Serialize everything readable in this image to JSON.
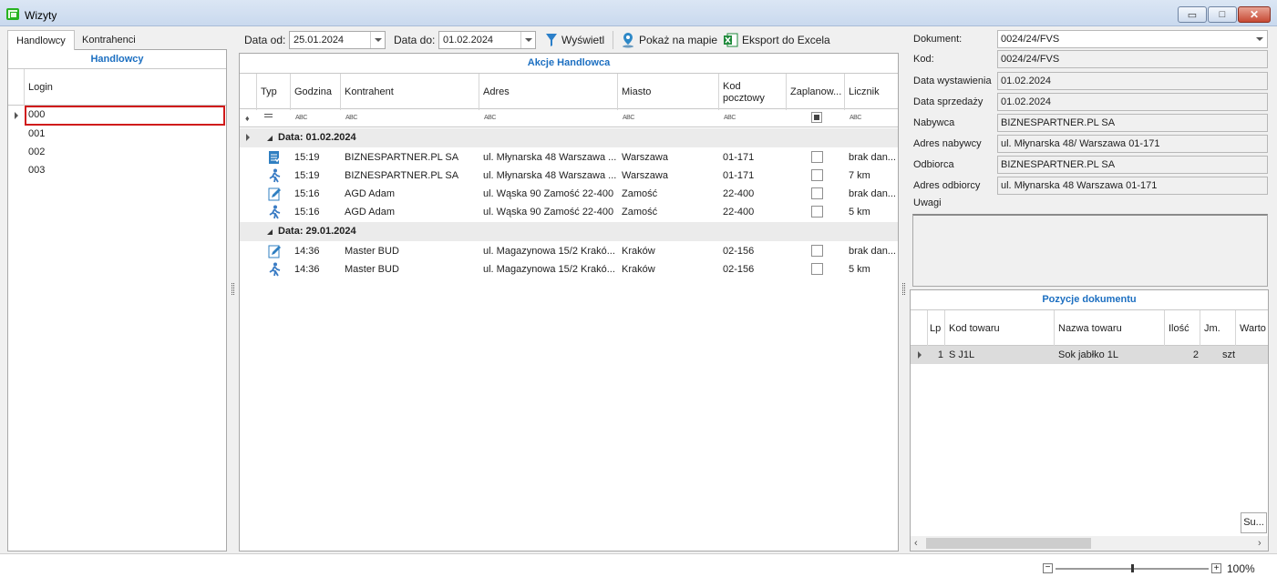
{
  "window": {
    "title": "Wizyty",
    "min": "▭",
    "max": "□",
    "close": "✕"
  },
  "left": {
    "tabs": [
      "Handlowcy",
      "Kontrahenci"
    ],
    "panel_title": "Handlowcy",
    "column": "Login",
    "rows": [
      "000",
      "001",
      "002",
      "003"
    ]
  },
  "toolbar": {
    "date_from_label": "Data od:",
    "date_from": "25.01.2024",
    "date_to_label": "Data do:",
    "date_to": "01.02.2024",
    "show": "Wyświetl",
    "map": "Pokaż na mapie",
    "excel": "Eksport do Excela"
  },
  "center": {
    "title": "Akcje Handlowca",
    "columns": [
      "Typ",
      "Godzina",
      "Kontrahent",
      "Adres",
      "Miasto",
      "Kod pocztowy",
      "Zaplanow...",
      "Licznik"
    ],
    "filter_abc": "ABC",
    "groups": [
      {
        "label": "Data: 01.02.2024",
        "rows": [
          {
            "icon": "document-check-icon",
            "time": "15:19",
            "client": "BIZNESPARTNER.PL SA",
            "address": "ul. Młynarska 48 Warszawa ...",
            "city": "Warszawa",
            "zip": "01-171",
            "counter": "brak dan..."
          },
          {
            "icon": "walking-person-icon",
            "time": "15:19",
            "client": "BIZNESPARTNER.PL SA",
            "address": "ul. Młynarska 48 Warszawa ...",
            "city": "Warszawa",
            "zip": "01-171",
            "counter": "7 km"
          },
          {
            "icon": "edit-document-icon",
            "time": "15:16",
            "client": "AGD Adam",
            "address": "ul. Wąska 90 Zamość 22-400",
            "city": "Zamość",
            "zip": "22-400",
            "counter": "brak dan..."
          },
          {
            "icon": "walking-person-icon",
            "time": "15:16",
            "client": "AGD Adam",
            "address": "ul. Wąska 90 Zamość 22-400",
            "city": "Zamość",
            "zip": "22-400",
            "counter": "5 km"
          }
        ]
      },
      {
        "label": "Data: 29.01.2024",
        "rows": [
          {
            "icon": "edit-document-icon",
            "time": "14:36",
            "client": "Master BUD",
            "address": "ul. Magazynowa 15/2 Krakó...",
            "city": "Kraków",
            "zip": "02-156",
            "counter": "brak dan..."
          },
          {
            "icon": "walking-person-icon",
            "time": "14:36",
            "client": "Master BUD",
            "address": "ul. Magazynowa 15/2 Krakó...",
            "city": "Kraków",
            "zip": "02-156",
            "counter": "5 km"
          }
        ]
      }
    ]
  },
  "right": {
    "fields": [
      {
        "label": "Dokument:",
        "value": "0024/24/FVS"
      },
      {
        "label": "Kod:",
        "value": "0024/24/FVS"
      },
      {
        "label": "Data wystawienia",
        "value": "01.02.2024"
      },
      {
        "label": "Data sprzedaży",
        "value": "01.02.2024"
      },
      {
        "label": "Nabywca",
        "value": "BIZNESPARTNER.PL SA"
      },
      {
        "label": "Adres nabywcy",
        "value": "ul. Młynarska 48/ Warszawa 01-171"
      },
      {
        "label": "Odbiorca",
        "value": "BIZNESPARTNER.PL SA"
      },
      {
        "label": "Adres odbiorcy",
        "value": "ul. Młynarska 48 Warszawa 01-171"
      }
    ],
    "notes_label": "Uwagi",
    "positions_title": "Pozycje dokumentu",
    "pos_columns": [
      "Lp",
      "Kod towaru",
      "Nazwa towaru",
      "Ilość",
      "Jm.",
      "Warto"
    ],
    "pos_row": {
      "lp": "1",
      "code": "S J1L",
      "name": "Sok jabłko 1L",
      "qty": "2",
      "unit": "szt"
    },
    "sum_button": "Su..."
  },
  "status": {
    "zoom": "100%",
    "zoom_minus": "−",
    "zoom_plus": "+",
    "zoom_level": 0.5
  }
}
